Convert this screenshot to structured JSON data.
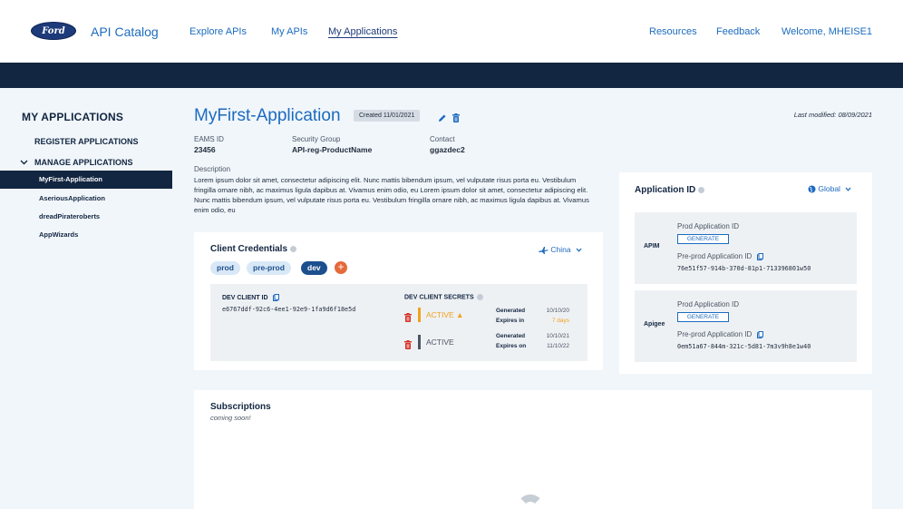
{
  "header": {
    "logo_text": "Ford",
    "app_title": "API Catalog",
    "nav": [
      "Explore APIs",
      "My APIs",
      "My Applications"
    ],
    "active_nav": "My Applications",
    "right_nav": [
      "Resources",
      "Feedback",
      "Welcome, MHEISE1"
    ]
  },
  "sidebar": {
    "heading": "MY APPLICATIONS",
    "register": "REGISTER APPLICATIONS",
    "manage": "MANAGE APPLICATIONS",
    "apps": [
      "MyFirst-Application",
      "AseriousApplication",
      "dreadPirateroberts",
      "AppWizards"
    ],
    "active_app": "MyFirst-Application"
  },
  "app": {
    "title": "MyFirst-Application",
    "created": "Created 11/01/2021",
    "last_modified": "Last modified: 08/09/2021",
    "eams_label": "EAMS ID",
    "eams_value": "23456",
    "security_label": "Security Group",
    "security_value": "API-reg-ProductName",
    "contact_label": "Contact",
    "contact_value": "ggazdec2",
    "description_label": "Description",
    "description": "Lorem ipsum dolor sit amet, consectetur adipiscing elit. Nunc mattis bibendum ipsum, vel vulputate risus porta eu. Vestibulum fringilla ornare nibh, ac maximus ligula dapibus at. Vivamus enim odio, eu Lorem ipsum dolor sit amet, consectetur adipiscing elit. Nunc mattis bibendum ipsum, vel vulputate risus porta eu. Vestibulum fringilla ornare nibh, ac maximus ligula dapibus at. Vivamus enim odio, eu"
  },
  "credentials": {
    "title": "Client Credentials",
    "region": "China",
    "envs": [
      "prod",
      "pre-prod",
      "dev"
    ],
    "active_env": "dev",
    "add_label": "+",
    "client_id_label": "DEV CLIENT ID",
    "client_id": "e6767ddf-92c6-4ee1-92e9-1fa9d6f18e5d",
    "secrets_label": "DEV CLIENT SECRETS",
    "secrets": [
      {
        "status": "ACTIVE ▲",
        "generated_label": "Generated",
        "generated": "10/10/20",
        "expires_label": "Expires in",
        "expires": "7 days"
      },
      {
        "status": "ACTIVE",
        "generated_label": "Generated",
        "generated": "10/10/21",
        "expires_label": "Expires on",
        "expires": "11/10/22"
      }
    ]
  },
  "application_id": {
    "title": "Application ID",
    "region": "Global",
    "platforms": [
      {
        "name": "APIM",
        "prod_label": "Prod Application ID",
        "generate": "GENERATE",
        "preprod_label": "Pre-prod Application ID",
        "preprod_value": "76e51f57-914b-370d-81p1-713396801w50"
      },
      {
        "name": "Apigee",
        "prod_label": "Prod Application ID",
        "generate": "GENERATE",
        "preprod_label": "Pre-prod Application ID",
        "preprod_value": "0em51a67-844m-321c-5d81-7m3v9h8e1w40"
      }
    ]
  },
  "subscriptions": {
    "title": "Subscriptions",
    "note": "coming soon!"
  },
  "colors": {
    "primary": "#1c6bbf",
    "navy": "#122641",
    "warning": "#f0a21c",
    "danger": "#d62d20",
    "add": "#e46a3b"
  }
}
